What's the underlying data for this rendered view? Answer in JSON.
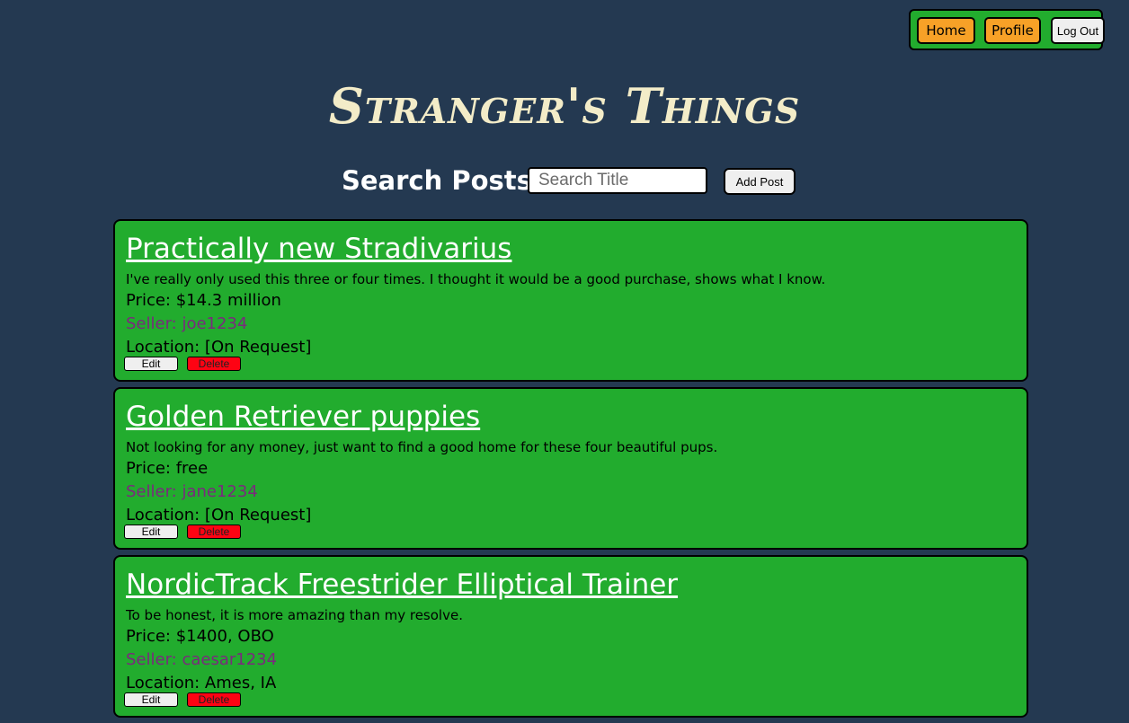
{
  "nav": {
    "home_label": "Home",
    "profile_label": "Profile",
    "logout_label": "Log Out"
  },
  "header": {
    "title": "Stranger's Things"
  },
  "search": {
    "label": "Search Posts",
    "placeholder": "Search Title",
    "value": "",
    "add_post_label": "Add Post"
  },
  "colors": {
    "background": "#243951",
    "card": "#22ac2e",
    "nav_accent": "#f7a127",
    "seller": "#7a2a7d",
    "delete": "#fe0313",
    "title": "#f3ecc8"
  },
  "posts": [
    {
      "title": "Practically new Stradivarius",
      "description": "I've really only used this three or four times.  I thought it would be a good purchase, shows what I know.",
      "price": "Price: $14.3 million",
      "seller": "Seller: joe1234",
      "location": "Location: [On Request]",
      "edit_label": "Edit",
      "delete_label": "Delete"
    },
    {
      "title": "Golden Retriever puppies",
      "description": "Not looking for any money, just want to find a good home for these four beautiful pups.",
      "price": "Price: free",
      "seller": "Seller: jane1234",
      "location": "Location: [On Request]",
      "edit_label": "Edit",
      "delete_label": "Delete"
    },
    {
      "title": "NordicTrack Freestrider Elliptical Trainer",
      "description": "To be honest, it is more amazing than my resolve.",
      "price": "Price: $1400, OBO",
      "seller": "Seller: caesar1234",
      "location": "Location: Ames, IA",
      "edit_label": "Edit",
      "delete_label": "Delete"
    }
  ]
}
